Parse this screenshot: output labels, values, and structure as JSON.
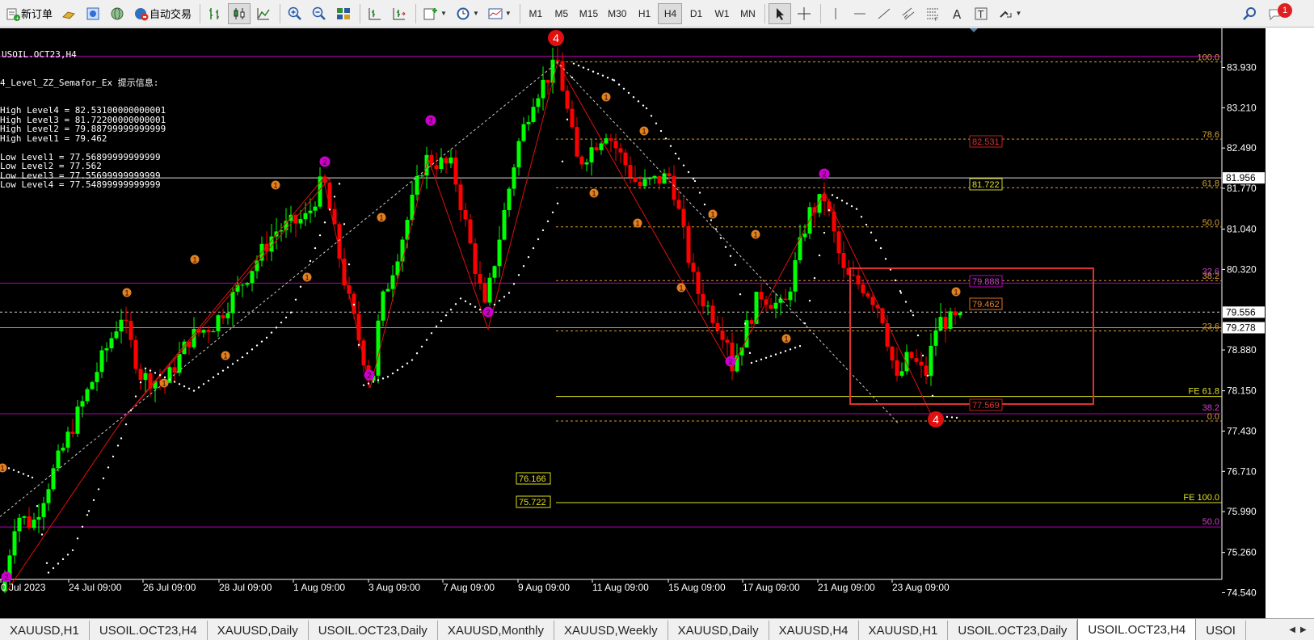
{
  "toolbar": {
    "new_order_label": "新订单",
    "auto_trade_label": "自动交易",
    "timeframes": [
      "M1",
      "M5",
      "M15",
      "M30",
      "H1",
      "H4",
      "D1",
      "W1",
      "MN"
    ],
    "active_timeframe": "H4",
    "notification_count": "1"
  },
  "chart": {
    "symbol_title": "USOIL.OCT23,H4",
    "indicator_title": "4_Level_ZZ_Semafor_Ex 提示信息:",
    "info_lines": [
      "High Level4 = 82.53100000000001",
      "High Level3 = 81.72200000000001",
      "High Level2 = 79.88799999999999",
      "High Level1 = 79.462",
      "",
      "Low Level1 = 77.56899999999999",
      "Low Level2 = 77.562",
      "Low Level3 = 77.55699999999999",
      "Low Level4 = 77.54899999999999"
    ],
    "price_axis": [
      "83.930",
      "83.210",
      "82.490",
      "81.770",
      "81.040",
      "80.320",
      "79.556",
      "79.278",
      "78.880",
      "78.150",
      "77.430",
      "76.710",
      "75.990",
      "75.260",
      "74.540"
    ],
    "axis_highlight_white": "81.956",
    "axis_highlight_price": "79.556",
    "axis_highlight_bid": "79.278",
    "date_axis": [
      "0 Jul 2023",
      "24 Jul 09:00",
      "26 Jul 09:00",
      "28 Jul 09:00",
      "1 Aug 09:00",
      "3 Aug 09:00",
      "7 Aug 09:00",
      "9 Aug 09:00",
      "11 Aug 09:00",
      "15 Aug 09:00",
      "17 Aug 09:00",
      "21 Aug 09:00",
      "23 Aug 09:00"
    ],
    "fib_labels": [
      "100.0",
      "78.6",
      "61.8",
      "50.0",
      "38.2",
      "23.6",
      "FE 61.8",
      "0.0",
      "FE 100.0",
      "50.0",
      "38.2"
    ],
    "fib_label_left_38": "32.6",
    "price_boxes": [
      "82.531",
      "81.722",
      "79.888",
      "79.462",
      "77.569",
      "76.166",
      "75.722"
    ],
    "colors": {
      "bull": "#00ff00",
      "bear": "#ff0000",
      "magenta": "#cc00cc",
      "orange": "#e08020",
      "fib": "#d4a030",
      "yellow": "#e0e020"
    }
  },
  "tabs": [
    {
      "label": "XAUUSD,H1",
      "active": false
    },
    {
      "label": "USOIL.OCT23,H4",
      "active": false
    },
    {
      "label": "XAUUSD,Daily",
      "active": false
    },
    {
      "label": "USOIL.OCT23,Daily",
      "active": false
    },
    {
      "label": "XAUUSD,Monthly",
      "active": false
    },
    {
      "label": "XAUUSD,Weekly",
      "active": false
    },
    {
      "label": "XAUUSD,Daily",
      "active": false
    },
    {
      "label": "XAUUSD,H4",
      "active": false
    },
    {
      "label": "XAUUSD,H1",
      "active": false
    },
    {
      "label": "USOIL.OCT23,Daily",
      "active": false
    },
    {
      "label": "USOIL.OCT23,H4",
      "active": true
    },
    {
      "label": "USOI",
      "active": false
    }
  ]
}
